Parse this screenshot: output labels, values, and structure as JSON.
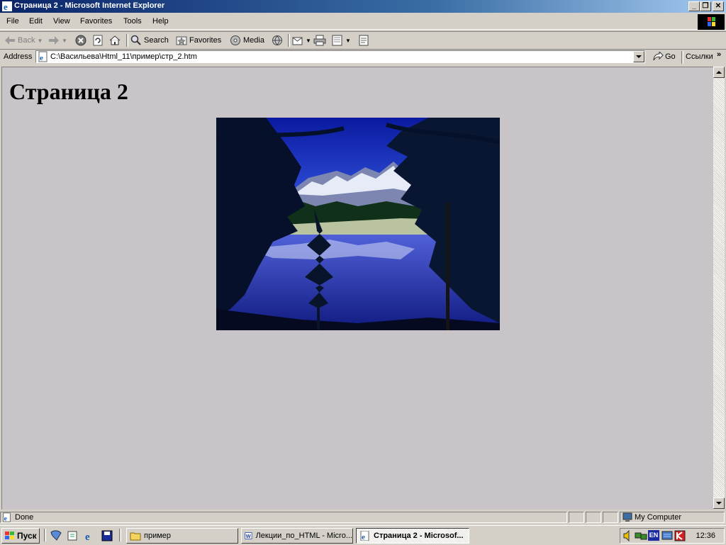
{
  "window": {
    "title": "Страница 2 - Microsoft Internet Explorer",
    "caption_buttons": {
      "minimize": "_",
      "restore": "❐",
      "close": "✕"
    }
  },
  "menu": [
    "File",
    "Edit",
    "View",
    "Favorites",
    "Tools",
    "Help"
  ],
  "toolbar": {
    "back_label": "Back",
    "search_label": "Search",
    "favorites_label": "Favorites",
    "media_label": "Media"
  },
  "address": {
    "label": "Address",
    "value": "C:\\Васильева\\Html_11\\пример\\стр_2.htm",
    "go_label": "Go",
    "links_label": "Ссылки",
    "chevron": "»"
  },
  "page": {
    "heading": "Страница 2",
    "image": "mountain-lake-photo"
  },
  "status": {
    "text": "Done",
    "zone": "My Computer"
  },
  "taskbar": {
    "start_label": "Пуск",
    "tasks": [
      {
        "label": "пример",
        "active": false
      },
      {
        "label": "Лекции_по_HTML - Micro...",
        "active": false
      },
      {
        "label": "Страница 2 - Microsof...",
        "active": true
      }
    ],
    "tray_lang": "EN",
    "clock": "12:36"
  },
  "colors": {
    "titlebar_start": "#0a246a",
    "titlebar_end": "#a6caf0",
    "chrome": "#d4d0c8",
    "page_background": "#c8c4c8"
  }
}
